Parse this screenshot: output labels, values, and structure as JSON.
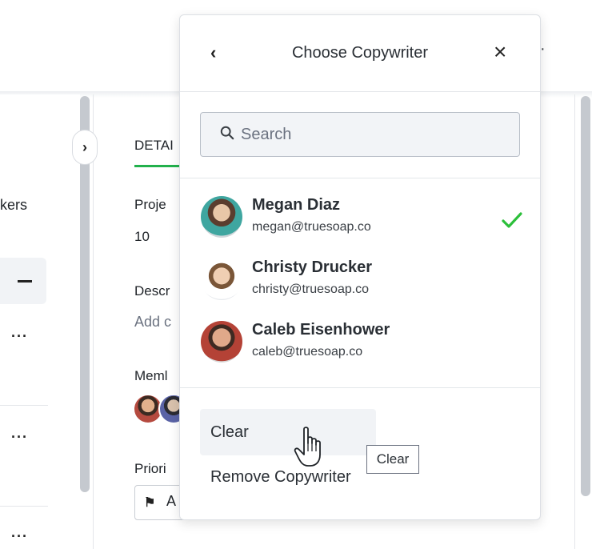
{
  "background": {
    "left_nav_fragment": "kers",
    "details_tab": "DETAI",
    "project_label": "Proje",
    "project_value": "10",
    "description_label": "Descr",
    "description_placeholder": "Add c",
    "members_label": "Meml",
    "priority_label": "Priori",
    "priority_value": "A"
  },
  "popup": {
    "title": "Choose Copywriter",
    "back_icon": "chevron-left-icon",
    "close_icon": "close-icon",
    "search": {
      "placeholder": "Search",
      "icon": "search-icon"
    },
    "people": [
      {
        "name": "Megan Diaz",
        "email": "megan@truesoap.co",
        "selected": true
      },
      {
        "name": "Christy Drucker",
        "email": "christy@truesoap.co",
        "selected": false
      },
      {
        "name": "Caleb Eisenhower",
        "email": "caleb@truesoap.co",
        "selected": false
      }
    ],
    "clear_label": "Clear",
    "remove_label": "Remove Copywriter"
  },
  "tooltip": {
    "text": "Clear"
  },
  "colors": {
    "accent_green": "#22b14c",
    "check_green": "#2bbf3a",
    "hover_bg": "#f1f3f6"
  }
}
